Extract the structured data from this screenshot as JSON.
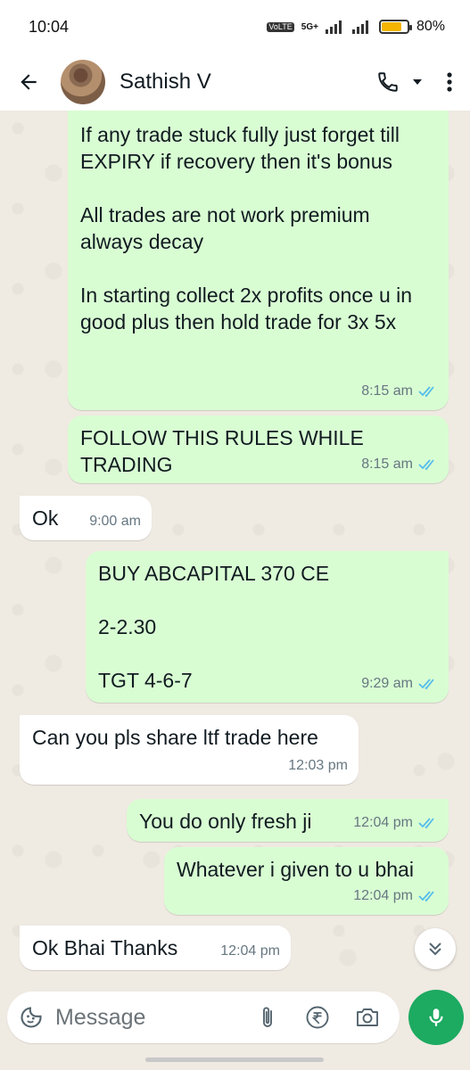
{
  "status_bar": {
    "time": "10:04",
    "volte": "VoLTE",
    "network": "5G+",
    "battery": "80%"
  },
  "header": {
    "contact_name": "Sathish V"
  },
  "messages": [
    {
      "dir": "out",
      "text": "If any trade stuck fully just forget till EXPIRY if recovery then it's bonus\n\nAll trades are not work premium always decay\n\nIn starting collect 2x profits once u in good plus then hold trade for 3x 5x",
      "time": "8:15 am",
      "read": true
    },
    {
      "dir": "out",
      "text": "FOLLOW THIS RULES WHILE TRADING",
      "time": "8:15 am",
      "read": true
    },
    {
      "dir": "in",
      "text": "Ok",
      "time": "9:00 am"
    },
    {
      "dir": "out",
      "text": "BUY ABCAPITAL 370 CE\n\n2-2.30\n\nTGT 4-6-7",
      "time": "9:29 am",
      "read": true
    },
    {
      "dir": "in",
      "text": "Can you pls share ltf trade here",
      "time": "12:03 pm"
    },
    {
      "dir": "out",
      "text": "You do only fresh ji",
      "time": "12:04 pm",
      "read": true
    },
    {
      "dir": "out",
      "text": "Whatever i given to u bhai",
      "time": "12:04 pm",
      "read": true
    },
    {
      "dir": "in",
      "text": "Ok Bhai Thanks",
      "time": "12:04 pm"
    }
  ],
  "composer": {
    "placeholder": "Message"
  },
  "icons": {
    "back": "arrow-left-icon",
    "call": "phone-icon",
    "call_menu": "caret-down-icon",
    "more": "more-vert-icon",
    "emoji": "sticker-icon",
    "attach": "paperclip-icon",
    "payment": "rupee-icon",
    "camera": "camera-icon",
    "mic": "mic-icon",
    "scroll": "double-chevron-down-icon",
    "read": "double-check-icon"
  },
  "colors": {
    "outgoing": "#d9fdd3",
    "incoming": "#ffffff",
    "accent": "#1daa61",
    "read_tick": "#53bdeb",
    "wallpaper": "#efeae2"
  }
}
